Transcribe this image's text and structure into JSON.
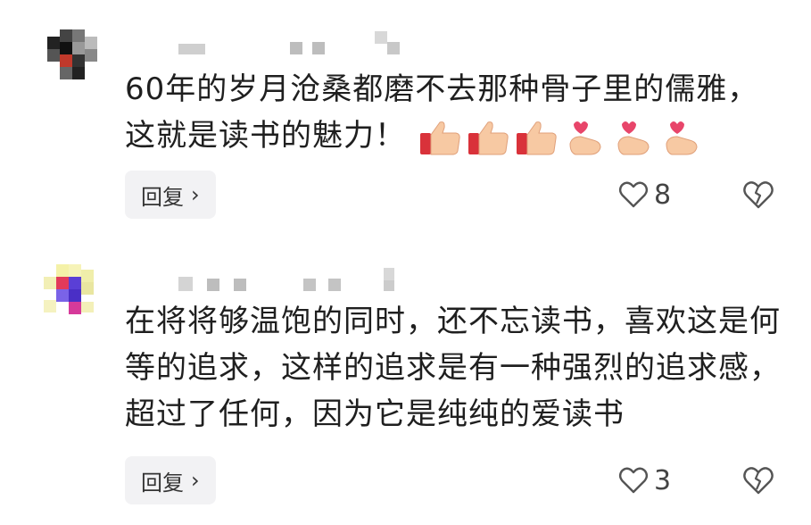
{
  "comments": [
    {
      "text": "60年的岁月沧桑都磨不去那种骨子里的儒雅，这就是读书的魅力！",
      "emojis": [
        "thumbs-up-icon",
        "thumbs-up-icon",
        "thumbs-up-icon",
        "finger-heart-icon",
        "finger-heart-icon",
        "finger-heart-icon"
      ],
      "reply_label": "回复",
      "likes": "8"
    },
    {
      "text": "在将将够温饱的同时，还不忘读书，喜欢这是何等的追求，这样的追求是有一种强烈的追求感，超过了任何，因为它是纯纯的爱读书",
      "emojis": [],
      "reply_label": "回复",
      "likes": "3"
    }
  ],
  "colors": {
    "text": "#1f1f1f",
    "reply_bg": "#f2f2f4",
    "icon": "#555555",
    "emoji_skin": "#f7c9a3",
    "emoji_sleeve": "#d9323a",
    "emoji_heart": "#e8456a"
  }
}
